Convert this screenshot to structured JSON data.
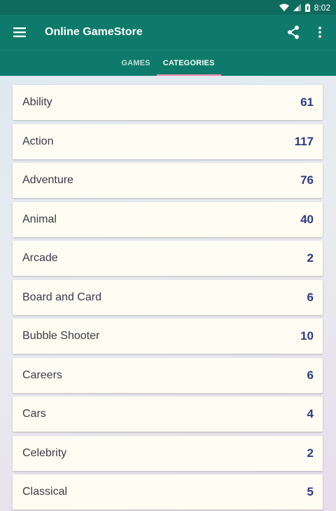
{
  "status_bar": {
    "time": "8:02"
  },
  "app_bar": {
    "title": "Online GameStore"
  },
  "tabs": [
    {
      "label": "GAMES",
      "active": false
    },
    {
      "label": "CATEGORIES",
      "active": true
    }
  ],
  "colors": {
    "app_bar": "#0e7a6b",
    "tab_indicator": "#f48fb1",
    "card_bg": "#fffdf3",
    "count_text": "#2d3a84"
  },
  "icons": {
    "menu": "hamburger-menu-icon",
    "share": "share-icon",
    "overflow": "more-vertical-icon"
  },
  "categories": [
    {
      "name": "Ability",
      "count": "61"
    },
    {
      "name": "Action",
      "count": "117"
    },
    {
      "name": "Adventure",
      "count": "76"
    },
    {
      "name": "Animal",
      "count": "40"
    },
    {
      "name": "Arcade",
      "count": "2"
    },
    {
      "name": "Board and Card",
      "count": "6"
    },
    {
      "name": "Bubble Shooter",
      "count": "10"
    },
    {
      "name": "Careers",
      "count": "6"
    },
    {
      "name": "Cars",
      "count": "4"
    },
    {
      "name": "Celebrity",
      "count": "2"
    },
    {
      "name": "Classical",
      "count": "5"
    }
  ]
}
